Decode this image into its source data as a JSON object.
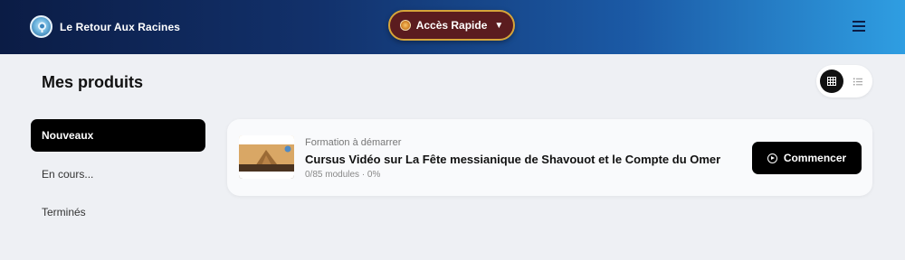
{
  "header": {
    "brand_name": "Le Retour Aux Racines",
    "quick_access_label": "Accès Rapide",
    "quick_access_caret": "▼",
    "menu_icon": "hamburger-icon"
  },
  "page": {
    "title": "Mes produits"
  },
  "view_toggle": {
    "selected": "grid",
    "options": [
      "grid",
      "list"
    ]
  },
  "sidebar": {
    "items": [
      {
        "label": "Nouveaux",
        "active": true
      },
      {
        "label": "En cours...",
        "active": false
      },
      {
        "label": "Terminés",
        "active": false
      }
    ]
  },
  "products": [
    {
      "category": "Formation à démarrer",
      "title": "Cursus Vidéo sur La Fête messianique de Shavouot et le Compte du Omer",
      "progress": "0/85 modules · 0%",
      "modules_done": 0,
      "modules_total": 85,
      "percent": 0,
      "action_label": "Commencer"
    }
  ],
  "colors": {
    "header_gradient_start": "#0b1c45",
    "header_gradient_end": "#2f9ee2",
    "quick_button_bg": "#5b1c1f",
    "quick_button_border": "#d6a53a",
    "accent_dark": "#000000"
  }
}
